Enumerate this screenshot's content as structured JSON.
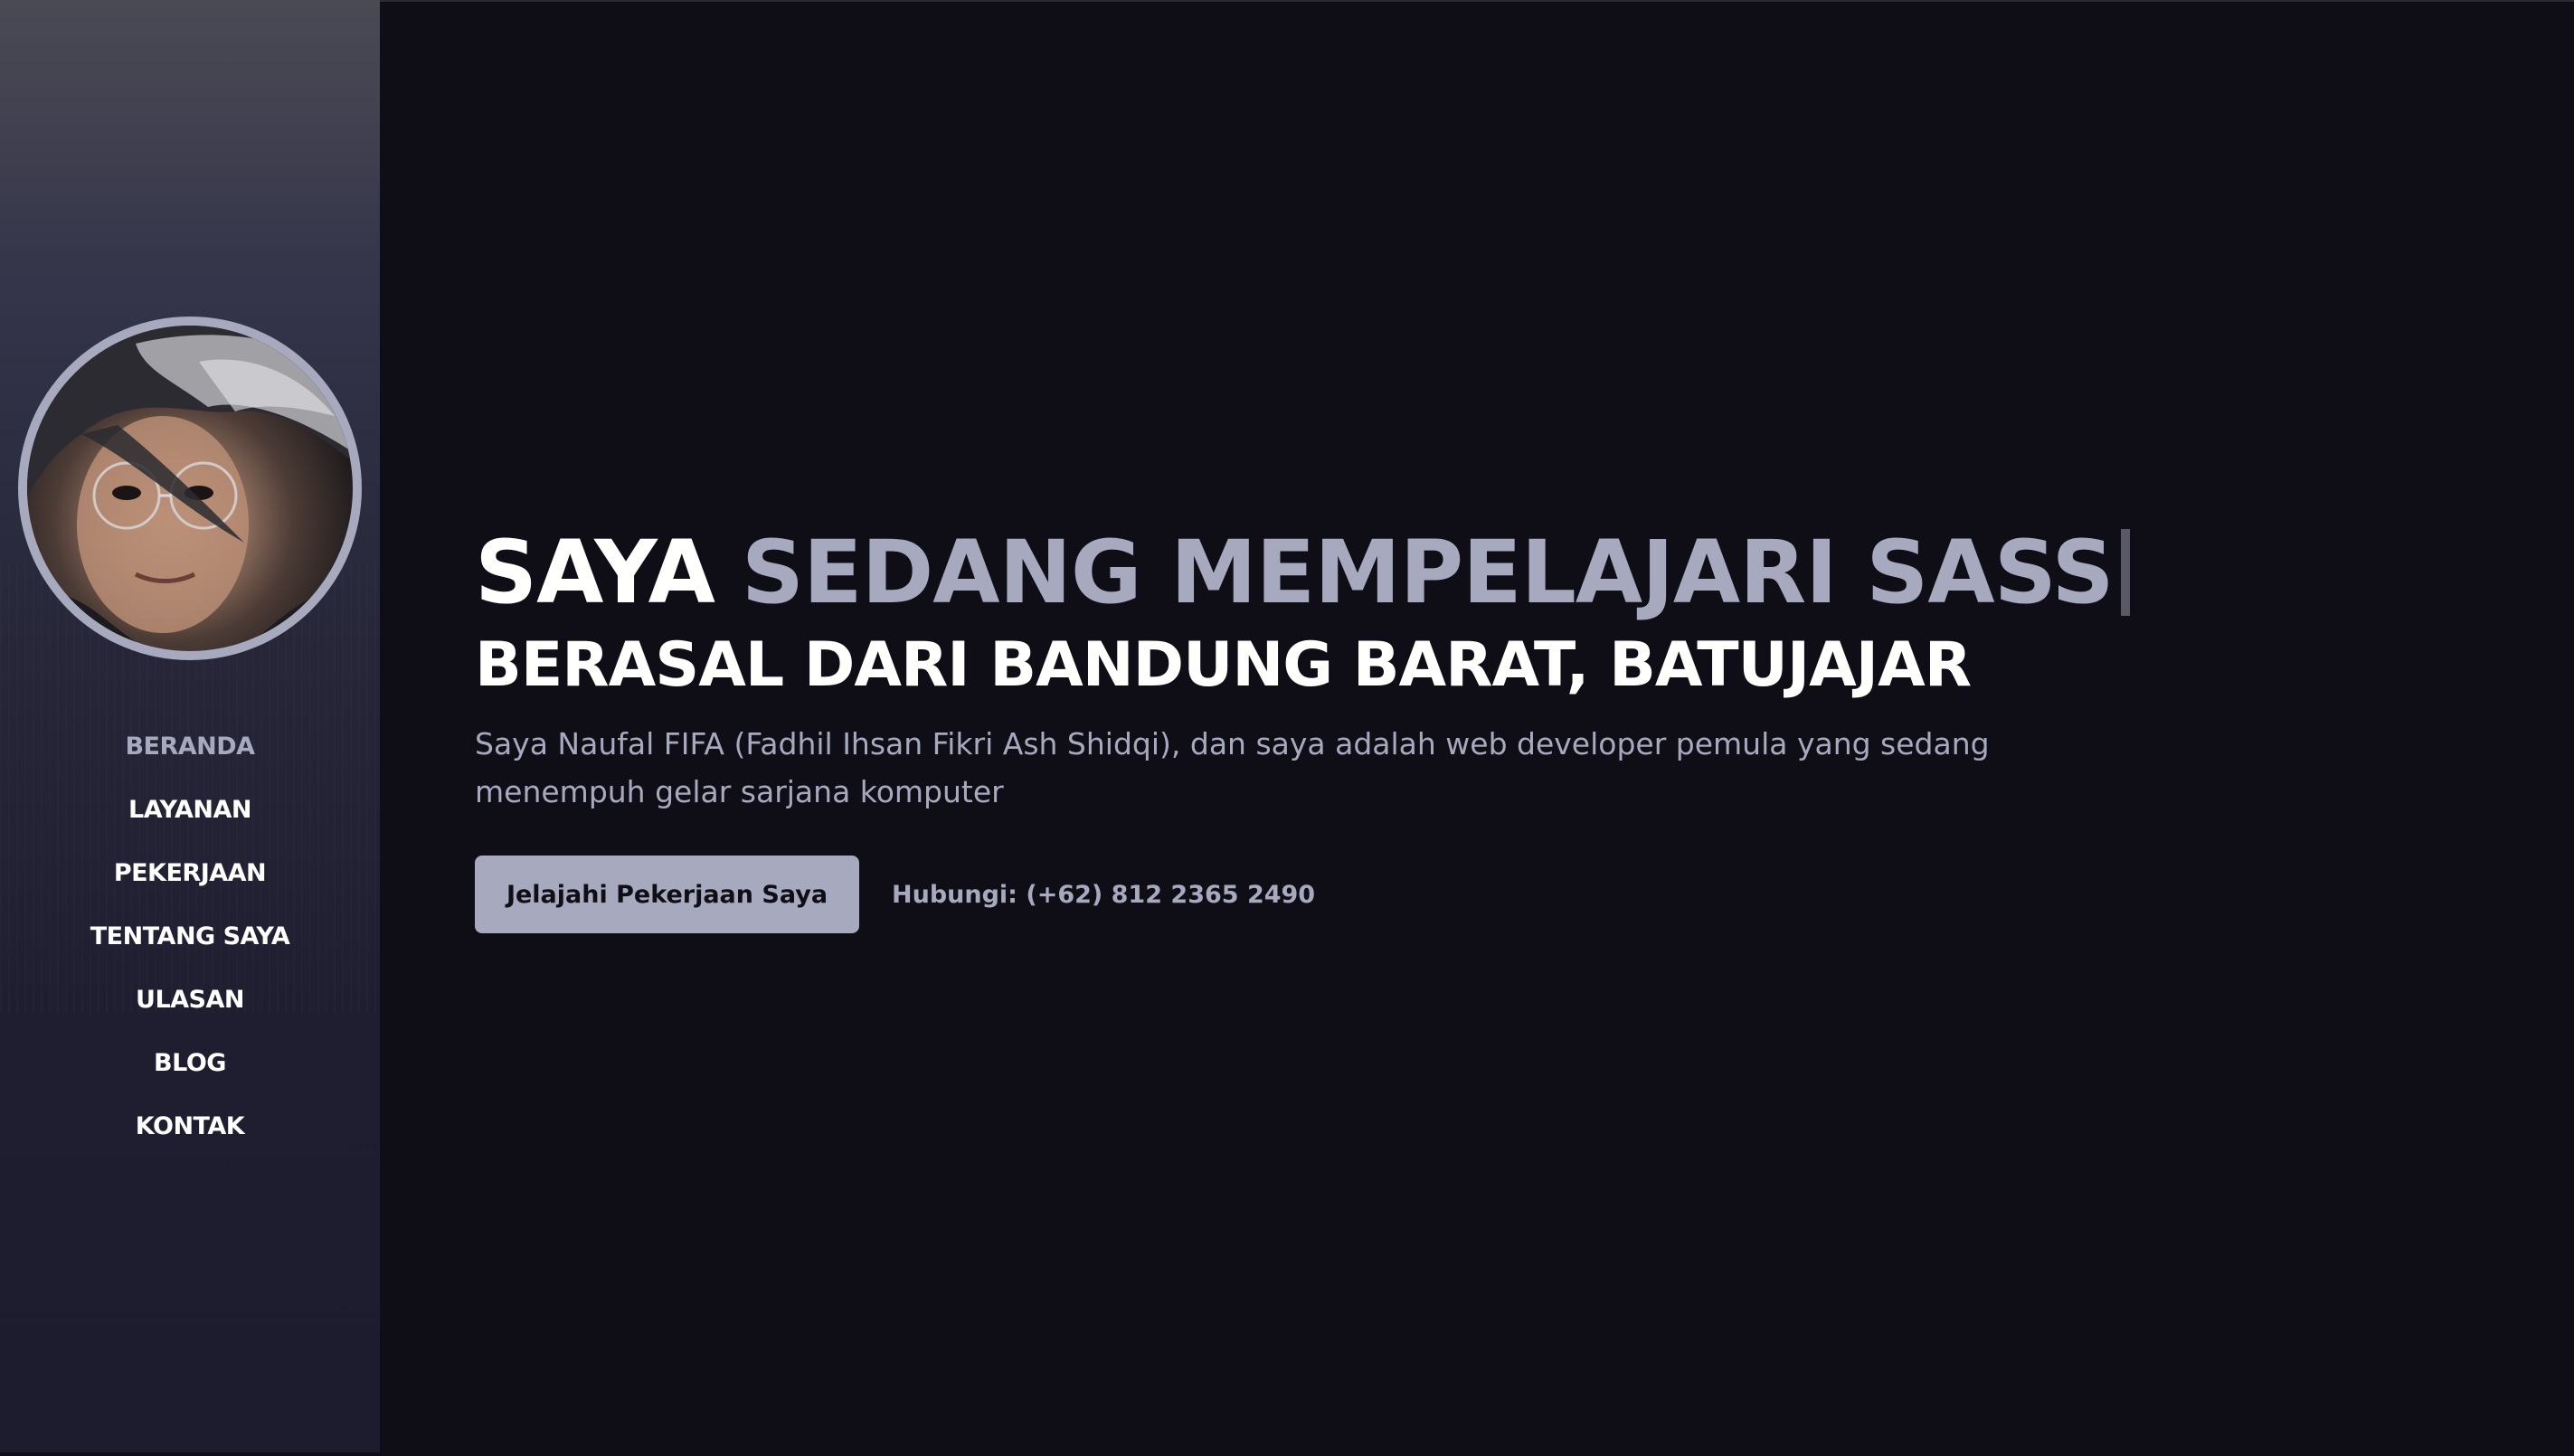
{
  "colors": {
    "background": "#0f0e17",
    "accent": "#a7a9be",
    "headline": "#fffffe",
    "sidebar": "#1c1c2e"
  },
  "sidebar": {
    "avatar_icon": "profile-photo",
    "nav": [
      {
        "label": "BERANDA",
        "active": true
      },
      {
        "label": "LAYANAN",
        "active": false
      },
      {
        "label": "PEKERJAAN",
        "active": false
      },
      {
        "label": "TENTANG SAYA",
        "active": false
      },
      {
        "label": "ULASAN",
        "active": false
      },
      {
        "label": "BLOG",
        "active": false
      },
      {
        "label": "KONTAK",
        "active": false
      }
    ]
  },
  "hero": {
    "headline_static": "SAYA",
    "headline_typed": "SEDANG MEMPELAJARI SASS",
    "subheadline": "BERASAL DARI BANDUNG BARAT, BATUJAJAR",
    "intro": "Saya Naufal FIFA (Fadhil Ihsan Fikri Ash Shidqi), dan saya adalah web developer pemula yang sedang menempuh gelar sarjana komputer",
    "cta_label": "Jelajahi Pekerjaan Saya",
    "contact_label": "Hubungi: (+62) 812 2365 2490"
  }
}
